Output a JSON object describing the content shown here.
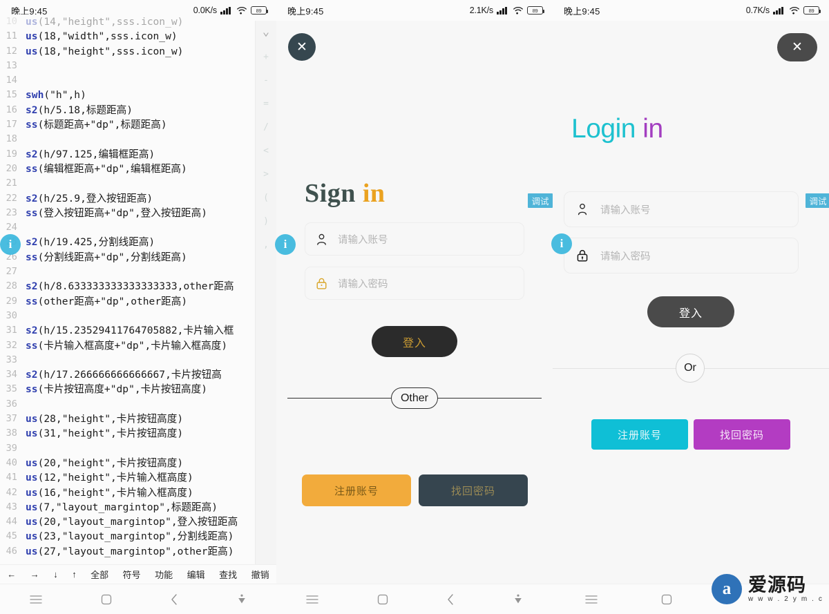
{
  "panels": [
    {
      "id": "code-editor",
      "statusbar": {
        "time": "晚上9:45",
        "speed": "0.0K/s",
        "battery": "89"
      },
      "toolbar": [
        {
          "name": "arrow-left",
          "label": "←"
        },
        {
          "name": "arrow-right",
          "label": "→"
        },
        {
          "name": "arrow-down",
          "label": "↓"
        },
        {
          "name": "arrow-up",
          "label": "↑"
        },
        {
          "name": "all",
          "label": "全部"
        },
        {
          "name": "symbol",
          "label": "符号"
        },
        {
          "name": "function",
          "label": "功能"
        },
        {
          "name": "edit",
          "label": "编辑"
        },
        {
          "name": "find",
          "label": "查找"
        },
        {
          "name": "undo",
          "label": "撤销"
        }
      ],
      "symbol_rail": [
        "+",
        "-",
        "=",
        "/",
        "<",
        ">",
        "(",
        ")",
        ","
      ],
      "code_lines": [
        {
          "n": "10",
          "kw": "us",
          "rest": "(14,\"height\",sss.icon_w)",
          "faded": true
        },
        {
          "n": "11",
          "kw": "us",
          "rest": "(18,\"width\",sss.icon_w)"
        },
        {
          "n": "12",
          "kw": "us",
          "rest": "(18,\"height\",sss.icon_w)"
        },
        {
          "n": "13",
          "kw": "",
          "rest": ""
        },
        {
          "n": "14",
          "kw": "",
          "rest": ""
        },
        {
          "n": "15",
          "kw": "swh",
          "rest": "(\"h\",h)"
        },
        {
          "n": "16",
          "kw": "s2",
          "rest": "(h/5.18,标题距高)"
        },
        {
          "n": "17",
          "kw": "ss",
          "rest": "(标题距高+\"dp\",标题距高)"
        },
        {
          "n": "18",
          "kw": "",
          "rest": ""
        },
        {
          "n": "19",
          "kw": "s2",
          "rest": "(h/97.125,编辑框距高)"
        },
        {
          "n": "20",
          "kw": "ss",
          "rest": "(编辑框距高+\"dp\",编辑框距高)"
        },
        {
          "n": "21",
          "kw": "",
          "rest": ""
        },
        {
          "n": "22",
          "kw": "s2",
          "rest": "(h/25.9,登入按钮距高)"
        },
        {
          "n": "23",
          "kw": "ss",
          "rest": "(登入按钮距高+\"dp\",登入按钮距高)"
        },
        {
          "n": "24",
          "kw": "",
          "rest": ""
        },
        {
          "n": "25",
          "kw": "s2",
          "rest": "(h/19.425,分割线距高)"
        },
        {
          "n": "26",
          "kw": "ss",
          "rest": "(分割线距高+\"dp\",分割线距高)"
        },
        {
          "n": "27",
          "kw": "",
          "rest": ""
        },
        {
          "n": "28",
          "kw": "s2",
          "rest": "(h/8.633333333333333333,other距高"
        },
        {
          "n": "29",
          "kw": "ss",
          "rest": "(other距高+\"dp\",other距高)"
        },
        {
          "n": "30",
          "kw": "",
          "rest": ""
        },
        {
          "n": "31",
          "kw": "s2",
          "rest": "(h/15.23529411764705882,卡片输入框"
        },
        {
          "n": "32",
          "kw": "ss",
          "rest": "(卡片输入框高度+\"dp\",卡片输入框高度)"
        },
        {
          "n": "33",
          "kw": "",
          "rest": ""
        },
        {
          "n": "34",
          "kw": "s2",
          "rest": "(h/17.266666666666667,卡片按钮高"
        },
        {
          "n": "35",
          "kw": "ss",
          "rest": "(卡片按钮高度+\"dp\",卡片按钮高度)"
        },
        {
          "n": "36",
          "kw": "",
          "rest": ""
        },
        {
          "n": "37",
          "kw": "us",
          "rest": "(28,\"height\",卡片按钮高度)"
        },
        {
          "n": "38",
          "kw": "us",
          "rest": "(31,\"height\",卡片按钮高度)"
        },
        {
          "n": "39",
          "kw": "",
          "rest": ""
        },
        {
          "n": "40",
          "kw": "us",
          "rest": "(20,\"height\",卡片按钮高度)"
        },
        {
          "n": "41",
          "kw": "us",
          "rest": "(12,\"height\",卡片输入框高度)"
        },
        {
          "n": "42",
          "kw": "us",
          "rest": "(16,\"height\",卡片输入框高度)"
        },
        {
          "n": "43",
          "kw": "us",
          "rest": "(7,\"layout_margintop\",标题距高)"
        },
        {
          "n": "44",
          "kw": "us",
          "rest": "(20,\"layout_margintop\",登入按钮距高"
        },
        {
          "n": "45",
          "kw": "us",
          "rest": "(23,\"layout_margintop\",分割线距高)"
        },
        {
          "n": "46",
          "kw": "us",
          "rest": "(27,\"layout_margintop\",other距高)"
        }
      ]
    },
    {
      "id": "sign-in-preview",
      "statusbar": {
        "time": "晚上9:45",
        "speed": "2.1K/s",
        "battery": "89"
      },
      "close_label": "✕",
      "title": {
        "part1": "Sign",
        "part2": "in"
      },
      "username_placeholder": "请输入账号",
      "password_placeholder": "请输入密码",
      "login_label": "登入",
      "divider_label": "Other",
      "register_label": "注册账号",
      "forgot_label": "找回密码"
    },
    {
      "id": "login-in-preview",
      "statusbar": {
        "time": "晚上9:45",
        "speed": "0.7K/s",
        "battery": "89"
      },
      "close_label": "✕",
      "title": {
        "part1": "Login",
        "part2": "in"
      },
      "username_placeholder": "请输入账号",
      "password_placeholder": "请输入密码",
      "login_label": "登入",
      "divider_label": "Or",
      "register_label": "注册账号",
      "forgot_label": "找回密码"
    }
  ],
  "debug_badges": {
    "label": "调试"
  },
  "watermark": {
    "logo": "a",
    "title": "爱源码",
    "url": "w w w . 2 y m . c"
  },
  "colors": {
    "sign_dark": "#3f514e",
    "sign_amber": "#eaa220",
    "login_cyan": "#1ec1cf",
    "login_purple": "#a33ec0",
    "register_orange": "#f2ab3c",
    "forgot_slate": "#36454f",
    "register_cyan": "#0fbfd6",
    "forgot_magenta": "#b33cc2",
    "debug_badge": "#4fb4d8",
    "code_keyword": "#2f3fae"
  }
}
